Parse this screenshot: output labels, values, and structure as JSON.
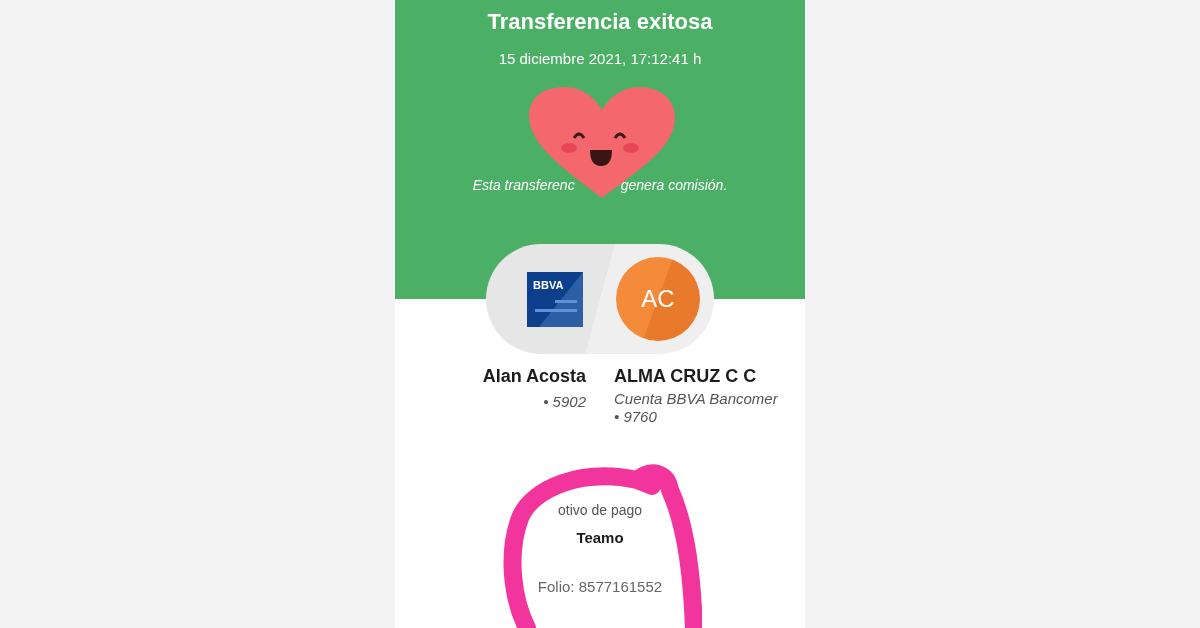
{
  "header": {
    "title": "Transferencia exitosa",
    "datetime": "15 diciembre 2021, 17:12:41 h",
    "note_parts": [
      "Esta transferenc",
      "genera comisión."
    ]
  },
  "card_logo": "BBVA",
  "sender": {
    "name": "Alan Acosta",
    "account": "• 5902"
  },
  "recipient": {
    "initials": "AC",
    "name": "ALMA CRUZ C C",
    "bank": "Cuenta BBVA Bancomer",
    "account": "• 9760"
  },
  "details": {
    "label": "otivo de pago",
    "value": "Teamo",
    "folio": "Folio: 8577161552"
  }
}
